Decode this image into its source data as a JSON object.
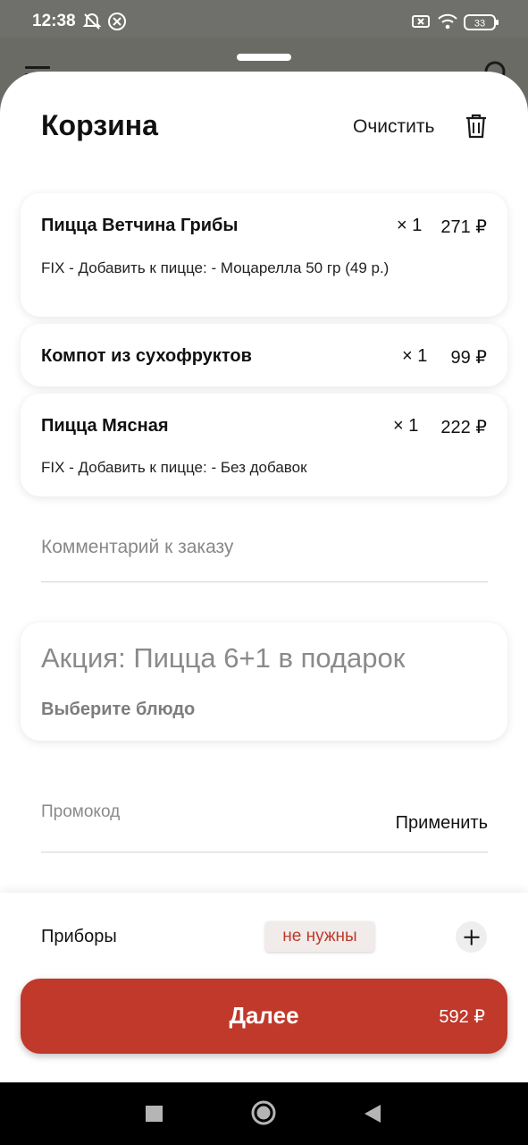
{
  "status_bar": {
    "time": "12:38",
    "battery": "33"
  },
  "cart": {
    "title": "Корзина",
    "clear_label": "Очистить",
    "items": [
      {
        "name": "Пицца Ветчина Грибы",
        "qty": "× 1",
        "price": "271 ₽",
        "modifier": "FIX - Добавить к пицце: - Моцарелла 50 гр (49 р.)"
      },
      {
        "name": "Компот из сухофруктов",
        "qty": "× 1",
        "price": "99 ₽",
        "modifier": ""
      },
      {
        "name": "Пицца  Мясная",
        "qty": "× 1",
        "price": "222 ₽",
        "modifier": "FIX - Добавить к пицце: - Без добавок"
      }
    ],
    "comment_placeholder": "Комментарий к заказу",
    "promo": {
      "title": "Акция: Пицца 6+1 в подарок",
      "choose": "Выберите блюдо"
    },
    "promocode": {
      "placeholder": "Промокод",
      "apply_label": "Применить"
    }
  },
  "footer": {
    "cutlery_label": "Приборы",
    "cutlery_value": "не нужны",
    "next_label": "Далее",
    "total": "592 ₽"
  },
  "colors": {
    "accent": "#c0392b",
    "chip_bg": "#f1ece9"
  }
}
